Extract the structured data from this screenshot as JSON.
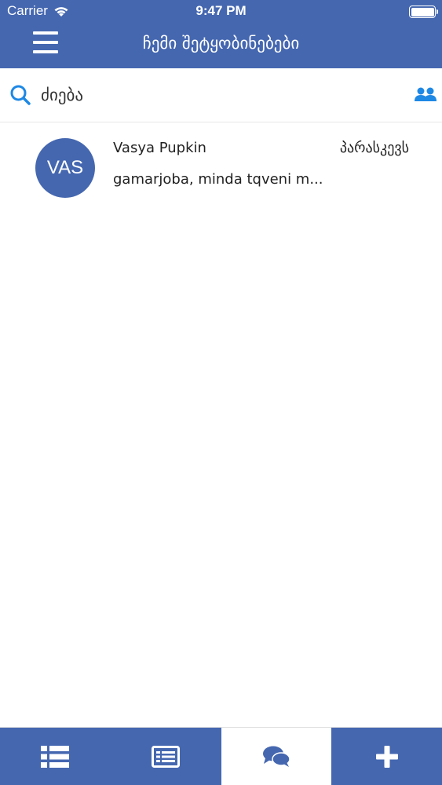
{
  "status_bar": {
    "carrier": "Carrier",
    "time": "9:47 PM"
  },
  "header": {
    "title": "ჩემი შეტყობინებები",
    "menu_icon": "hamburger-menu-icon"
  },
  "search": {
    "placeholder": "ძიება",
    "search_icon": "search-icon",
    "contacts_icon": "group-icon"
  },
  "chats": [
    {
      "avatar_initials": "VAS",
      "name": "Vasya Pupkin",
      "day": "პარასკევს",
      "preview": "gamarjoba, minda tqveni m..."
    }
  ],
  "tabs": [
    {
      "icon": "list-icon",
      "active": false
    },
    {
      "icon": "news-icon",
      "active": false
    },
    {
      "icon": "chat-bubbles-icon",
      "active": true
    },
    {
      "icon": "plus-icon",
      "active": false
    }
  ],
  "colors": {
    "primary": "#4567b0",
    "accent": "#1e88e5",
    "background": "#ffffff"
  }
}
